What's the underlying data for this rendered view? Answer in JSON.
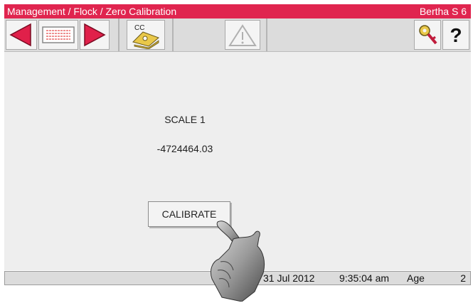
{
  "titlebar": {
    "path": "Management / Flock / Zero Calibration",
    "device": "Bertha S 6"
  },
  "toolbar": {
    "buttons": [
      {
        "icon": "arrow-left-icon"
      },
      {
        "icon": "list-card-icon"
      },
      {
        "icon": "arrow-right-icon"
      },
      {
        "icon": "calibration-cc-icon",
        "text": "CC"
      },
      {
        "icon": "warning-triangle-icon"
      },
      {
        "icon": "key-icon"
      },
      {
        "icon": "help-icon",
        "text": "?"
      }
    ]
  },
  "main": {
    "scale_label": "SCALE 1",
    "scale_value": "-4724464.03",
    "calibrate_label": "CALIBRATE"
  },
  "statusbar": {
    "date": "31 Jul 2012",
    "time": "9:35:04 am",
    "age_label": "Age",
    "age_value": "2"
  },
  "colors": {
    "accent": "#e0254f",
    "arrow_red": "#e0204a",
    "key_yellow": "#e9c84a"
  }
}
